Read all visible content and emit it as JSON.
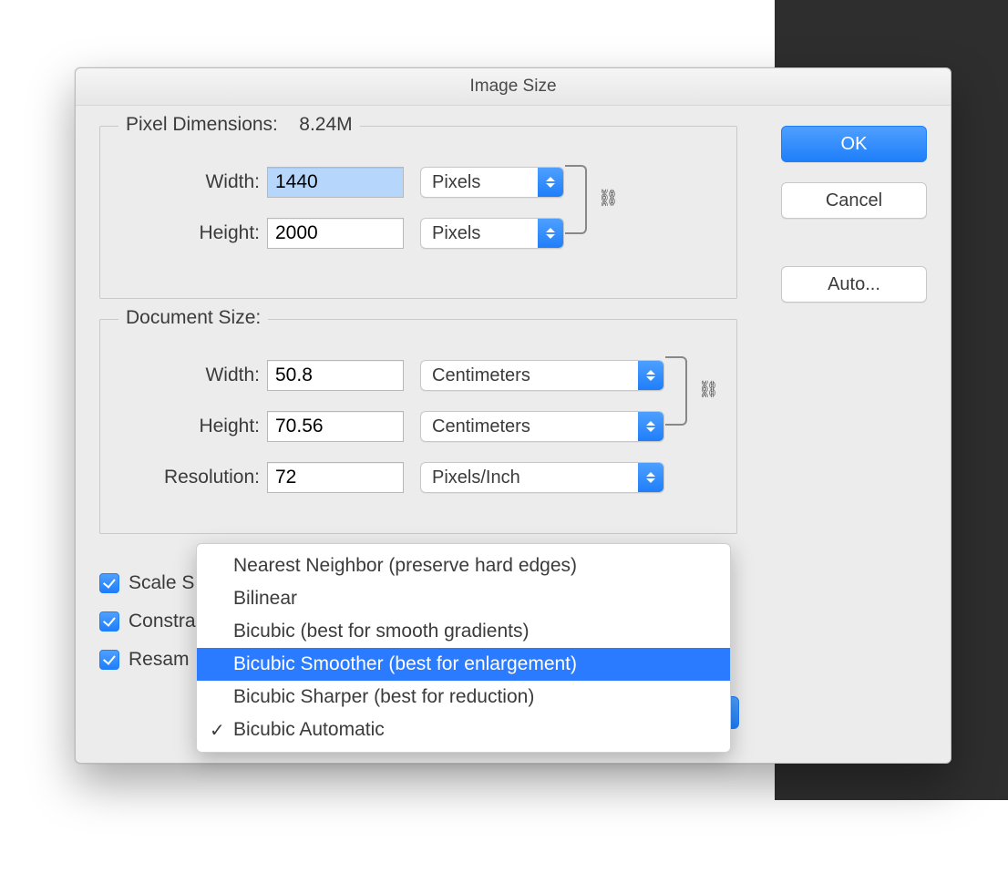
{
  "dialog": {
    "title": "Image Size",
    "buttons": {
      "ok": "OK",
      "cancel": "Cancel",
      "auto": "Auto..."
    }
  },
  "pixel_dimensions": {
    "legend_prefix": "Pixel Dimensions:",
    "size": "8.24M",
    "width_label": "Width:",
    "width_value": "1440",
    "width_unit": "Pixels",
    "height_label": "Height:",
    "height_value": "2000",
    "height_unit": "Pixels"
  },
  "document_size": {
    "legend": "Document Size:",
    "width_label": "Width:",
    "width_value": "50.8",
    "width_unit": "Centimeters",
    "height_label": "Height:",
    "height_value": "70.56",
    "height_unit": "Centimeters",
    "resolution_label": "Resolution:",
    "resolution_value": "72",
    "resolution_unit": "Pixels/Inch"
  },
  "checkboxes": {
    "scale_styles": "Scale S",
    "constrain": "Constra",
    "resample": "Resam"
  },
  "resample_menu": {
    "items": [
      "Nearest Neighbor (preserve hard edges)",
      "Bilinear",
      "Bicubic (best for smooth gradients)",
      "Bicubic Smoother (best for enlargement)",
      "Bicubic Sharper (best for reduction)",
      "Bicubic Automatic"
    ],
    "highlighted_index": 3,
    "checked_index": 5
  },
  "link_icon_glyph": "⛓"
}
